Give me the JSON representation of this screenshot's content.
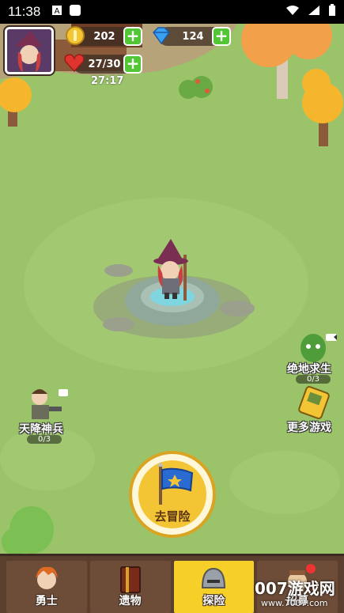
{
  "status_bar": {
    "time": "11:38"
  },
  "hud": {
    "gold": "202",
    "gems": "124",
    "hearts": "27/30",
    "timer": "27:17"
  },
  "side_buttons": {
    "survival": {
      "label": "绝地求生",
      "count": "0/3"
    },
    "more_games": {
      "label": "更多游戏"
    },
    "airdrop": {
      "label": "天降神兵",
      "count": "0/3"
    }
  },
  "adventure_button": {
    "label": "去冒险"
  },
  "tabs": [
    {
      "label": "勇士",
      "icon": "warrior-icon"
    },
    {
      "label": "遗物",
      "icon": "relic-book-icon"
    },
    {
      "label": "探险",
      "icon": "helmet-icon",
      "active": true
    },
    {
      "label": "招募",
      "icon": "recruit-icon"
    }
  ],
  "watermark": {
    "text": "007游戏网",
    "sub": "www.7007.com"
  },
  "colors": {
    "grass": "#9bc46a",
    "gold": "#f3c534",
    "tab_active": "#f6cf28",
    "tab_bar": "#5a3f2e"
  }
}
